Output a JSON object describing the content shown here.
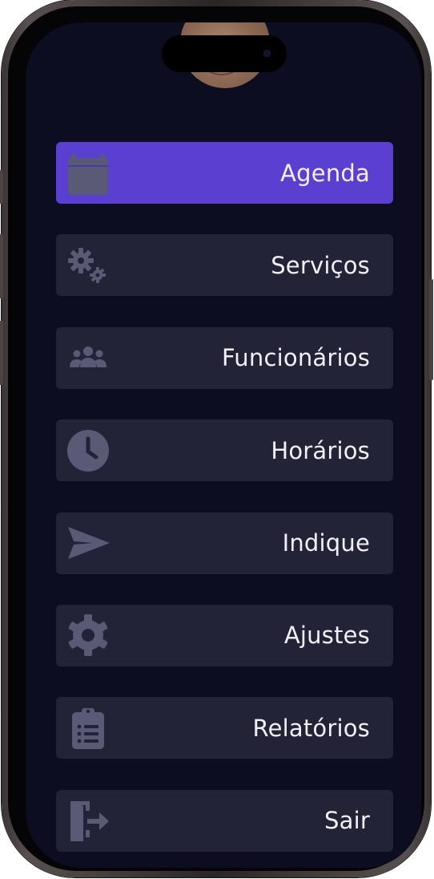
{
  "colors": {
    "screen_bg": "#0d0d22",
    "item_bg": "#232338",
    "active_bg": "#5b3fd0",
    "icon": "#5a5a77",
    "text": "#f0f0f6"
  },
  "menu": {
    "items": [
      {
        "label": "Agenda",
        "icon": "calendar-icon",
        "active": true
      },
      {
        "label": "Serviços",
        "icon": "gears-icon",
        "active": false
      },
      {
        "label": "Funcionários",
        "icon": "users-icon",
        "active": false
      },
      {
        "label": "Horários",
        "icon": "clock-icon",
        "active": false
      },
      {
        "label": "Indique",
        "icon": "send-icon",
        "active": false
      },
      {
        "label": "Ajustes",
        "icon": "gear-icon",
        "active": false
      },
      {
        "label": "Relatórios",
        "icon": "clipboard-list-icon",
        "active": false
      },
      {
        "label": "Sair",
        "icon": "exit-door-icon",
        "active": false
      }
    ]
  }
}
